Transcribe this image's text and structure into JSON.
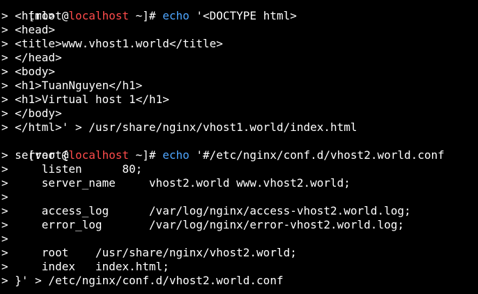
{
  "terminal": {
    "colors": {
      "background": "#000000",
      "text": "#ffffff",
      "hostname": "#ff4b4b",
      "command": "#4ea6ff"
    },
    "prompt": {
      "user_prefix": "[root@",
      "host": "localhost",
      "suffix": " ~]# "
    },
    "commands": [
      {
        "name": "echo",
        "arg_start": " '<DOCTYPE html>",
        "continuation": [
          "> <html>",
          "> <head>",
          "> <title>www.vhost1.world</title>",
          "> </head>",
          "> <body>",
          "> <h1>TuanNguyen</h1>",
          "> <h1>Virtual host 1</h1>",
          "> </body>",
          "> </html>' > /usr/share/nginx/vhost1.world/index.html"
        ]
      },
      {
        "name": "echo",
        "arg_start": " '#/etc/nginx/conf.d/vhost2.world.conf",
        "continuation": [
          "> server {",
          ">     listen      80;",
          ">     server_name     vhost2.world www.vhost2.world;",
          ">",
          ">     access_log      /var/log/nginx/access-vhost2.world.log;",
          ">     error_log       /var/log/nginx/error-vhost2.world.log;",
          ">",
          ">     root    /usr/share/nginx/vhost2.world;",
          ">     index   index.html;",
          "> }' > /etc/nginx/conf.d/vhost2.world.conf"
        ]
      }
    ]
  }
}
